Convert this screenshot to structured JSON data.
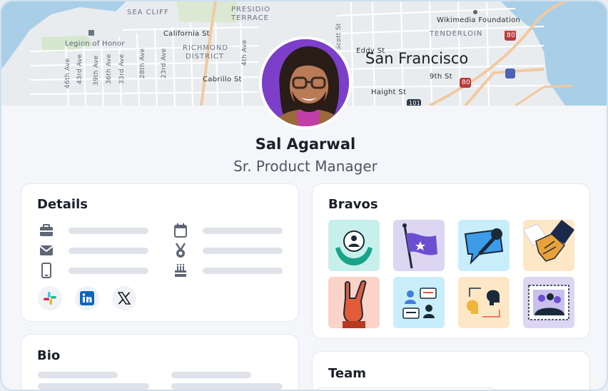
{
  "map": {
    "labels": {
      "sea_cliff": "SEA CLIFF",
      "presidio_terrace_1": "PRESIDIO",
      "presidio_terrace_2": "TERRACE",
      "wikimedia": "Wikimedia Foundation",
      "legion": "Legion of Honor",
      "california": "California St",
      "richmond_1": "RICHMOND",
      "richmond_2": "DISTRICT",
      "tenderloin": "TENDERLOIN",
      "cabrillo": "Cabrillo St",
      "haight": "Haight St",
      "ninth": "9th St",
      "scott": "Scott St",
      "eddy": "Eddy St",
      "city": "San Francisco",
      "ave_46": "46th Ave",
      "ave_43": "43rd Ave",
      "ave_39": "39th Ave",
      "ave_36": "36th Ave",
      "ave_33": "33rd Ave",
      "ave_28": "28th Ave",
      "ave_23": "23rd Ave",
      "ave_4": "4th Ave",
      "hwy_80a": "80",
      "hwy_80b": "80",
      "hwy_101": "101"
    }
  },
  "profile": {
    "name": "Sal Agarwal",
    "job_title": "Sr. Product Manager"
  },
  "details": {
    "title": "Details",
    "left_icons": [
      "briefcase-icon",
      "mail-icon",
      "phone-icon"
    ],
    "right_icons": [
      "calendar-icon",
      "award-icon",
      "birthday-cake-icon"
    ],
    "socials": [
      "slack-icon",
      "linkedin-icon",
      "x-icon"
    ]
  },
  "bravos": {
    "title": "Bravos",
    "items": [
      "hands-support",
      "purple-flag",
      "microphone",
      "handshake",
      "rock-hand",
      "team-chat",
      "ideas-exchange",
      "group-photo"
    ]
  },
  "bio": {
    "title": "Bio"
  },
  "team": {
    "title": "Team"
  },
  "colors": {
    "accent_purple": "#7b3fc9",
    "linkedin_blue": "#0a66c2",
    "bravo_teal": "#c7f0ec",
    "bravo_lavender": "#ddd6f3",
    "bravo_sky": "#c8eefc",
    "bravo_peach": "#fde7c7",
    "bravo_salmon": "#fbd3c8"
  }
}
